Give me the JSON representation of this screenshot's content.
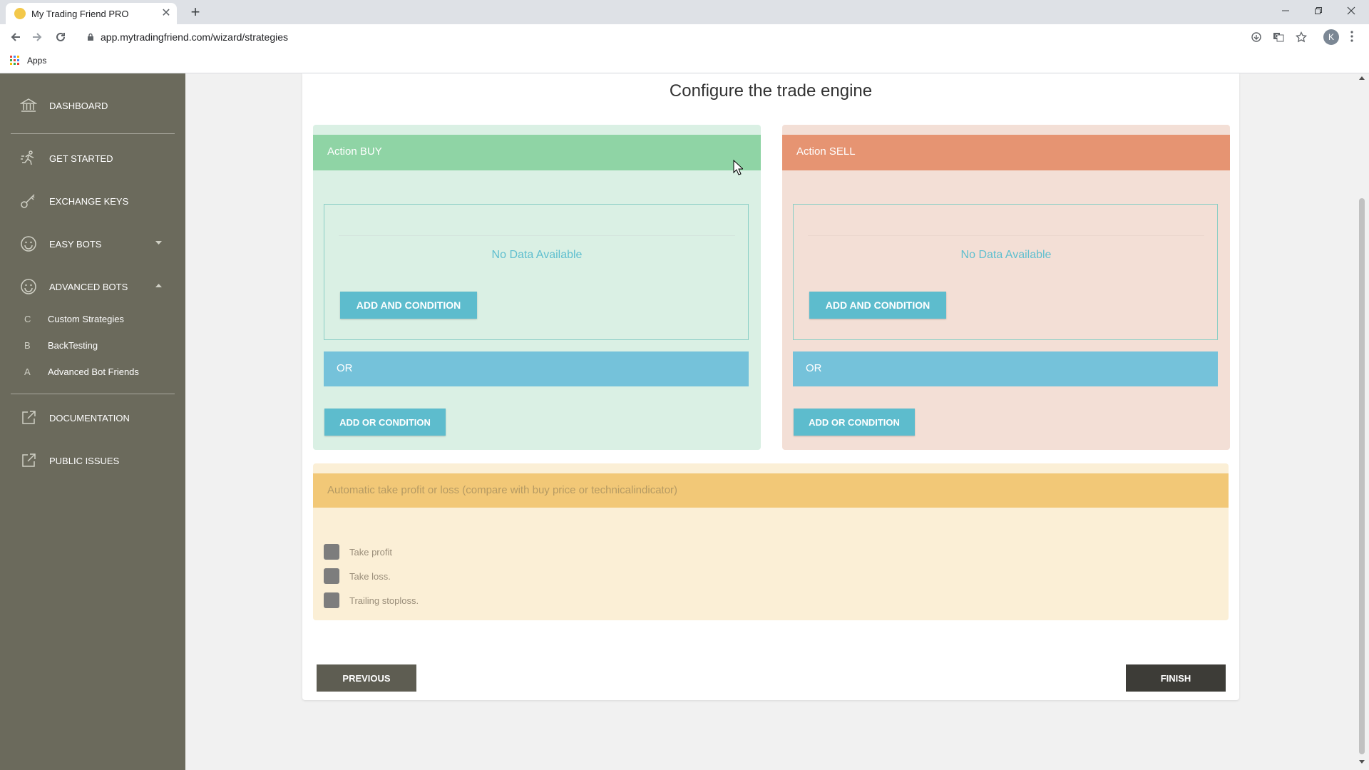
{
  "browser": {
    "tab_title": "My Trading Friend PRO",
    "url": "app.mytradingfriend.com/wizard/strategies",
    "profile_initial": "K",
    "bookmarks_apps": "Apps"
  },
  "sidebar": {
    "items": [
      {
        "label": "DASHBOARD",
        "icon": "bank-icon"
      },
      {
        "label": "GET STARTED",
        "icon": "running-icon"
      },
      {
        "label": "EXCHANGE KEYS",
        "icon": "key-icon"
      },
      {
        "label": "EASY BOTS",
        "icon": "smiley-icon"
      },
      {
        "label": "ADVANCED BOTS",
        "icon": "smiley-icon"
      },
      {
        "label": "DOCUMENTATION",
        "icon": "external-link-icon"
      },
      {
        "label": "PUBLIC ISSUES",
        "icon": "external-link-icon"
      }
    ],
    "advanced_sub": [
      {
        "letter": "C",
        "label": "Custom Strategies"
      },
      {
        "letter": "B",
        "label": "BackTesting"
      },
      {
        "letter": "A",
        "label": "Advanced Bot Friends"
      }
    ]
  },
  "page": {
    "title": "Configure the trade engine",
    "buy": {
      "header": "Action BUY",
      "no_data": "No Data Available",
      "add_and": "ADD AND CONDITION",
      "or_label": "OR",
      "add_or": "ADD OR CONDITION"
    },
    "sell": {
      "header": "Action SELL",
      "no_data": "No Data Available",
      "add_and": "ADD AND CONDITION",
      "or_label": "OR",
      "add_or": "ADD OR CONDITION"
    },
    "auto": {
      "header": "Automatic take profit or loss (compare with buy price or technicalindicator)",
      "options": [
        "Take profit",
        "Take loss.",
        "Trailing stoploss."
      ]
    },
    "previous": "PREVIOUS",
    "finish": "FINISH"
  },
  "colors": {
    "sidebar_bg": "#6b6a5c",
    "buy_header": "#8fd4a5",
    "buy_bg": "#daf0e4",
    "sell_header": "#e69472",
    "sell_bg": "#f3dfd6",
    "or_bar": "#75c2da",
    "button_teal": "#5dbccd",
    "auto_header": "#f2c877",
    "auto_bg": "#fbefd6"
  }
}
